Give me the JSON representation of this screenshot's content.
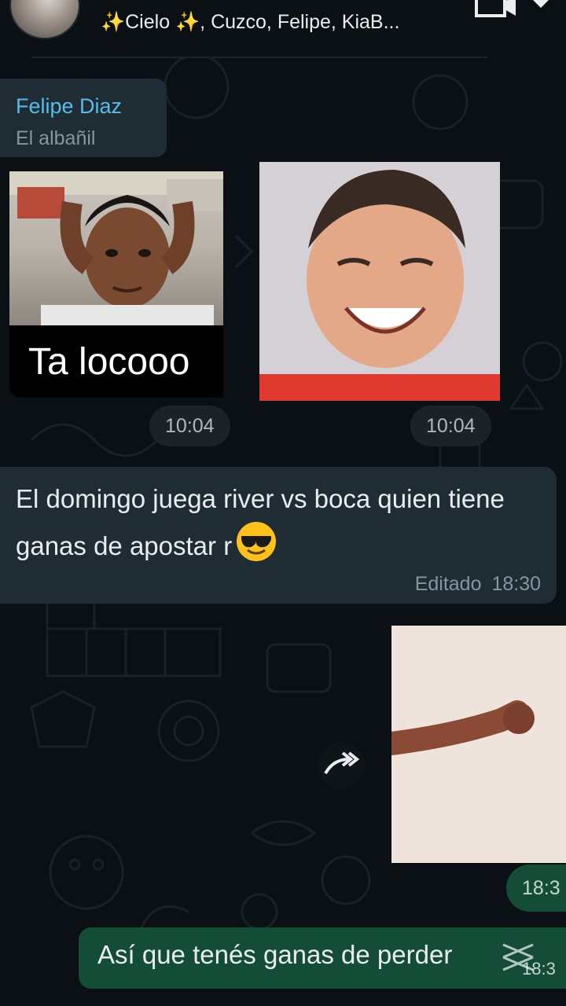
{
  "header": {
    "chat_title": "✨Cielo ✨, Cuzco, Felipe, KiaB...",
    "icons": [
      "avatar",
      "video-call-icon",
      "more-options-icon"
    ]
  },
  "messages": {
    "sender": {
      "name": "Felipe Diaz",
      "subtitle": "El albañil"
    },
    "sticker_left": {
      "caption": "Ta locooo",
      "time": "10:04"
    },
    "sticker_right": {
      "time": "10:04"
    },
    "incoming_text": {
      "text": "El domingo juega river vs boca quien tiene ganas de apostar r",
      "emoji": "smiling-face-with-sunglasses",
      "edited_label": "Editado",
      "time": "18:30"
    },
    "outgoing_media": {
      "time": "18:3",
      "forward_icon": "forward-icon"
    },
    "outgoing_text": {
      "text": "Así que tenés ganas de perder",
      "time": "18:3"
    }
  },
  "colors": {
    "background": "#0b1014",
    "incoming_bubble": "#1f2c33",
    "outgoing_bubble": "#144d37",
    "sender_name": "#53bdeb",
    "meta_text": "#8696a0"
  }
}
